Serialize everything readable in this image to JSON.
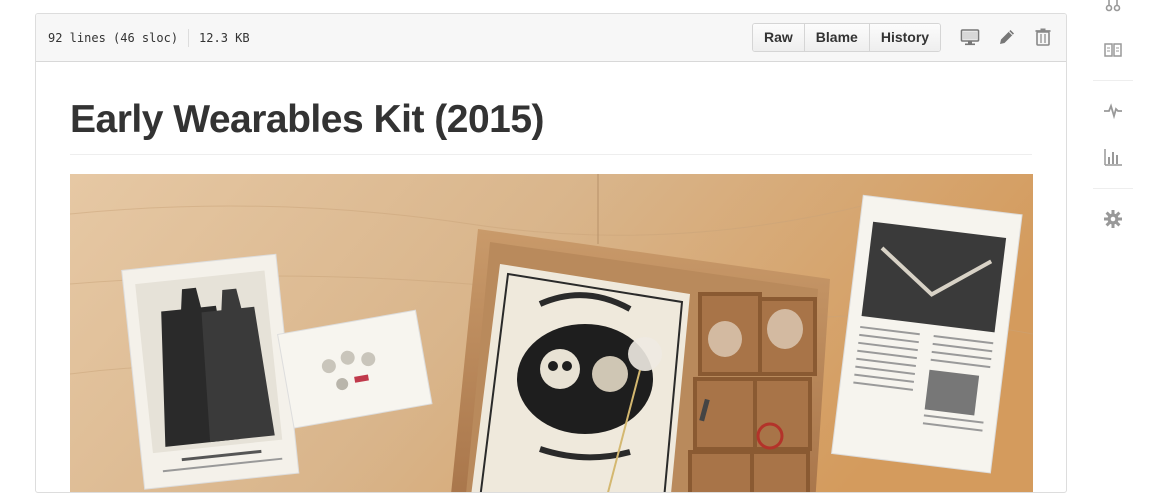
{
  "file": {
    "lines": "92 lines (46 sloc)",
    "size": "12.3 KB",
    "buttons": {
      "raw": "Raw",
      "blame": "Blame",
      "history": "History"
    },
    "icons": [
      "desktop-icon",
      "pencil-icon",
      "trash-icon"
    ]
  },
  "readme": {
    "title": "Early Wearables Kit (2015)",
    "image_alt": "Early Wearables Kit box with engravings"
  },
  "sidebar": {
    "icons": [
      "pull-request-icon",
      "book-icon",
      "pulse-icon",
      "graph-icon",
      "gear-icon"
    ]
  },
  "colors": {
    "header_bg": "#f7f7f7",
    "border": "#dddddd",
    "icon": "#888888",
    "wood": "#d9b48a"
  }
}
